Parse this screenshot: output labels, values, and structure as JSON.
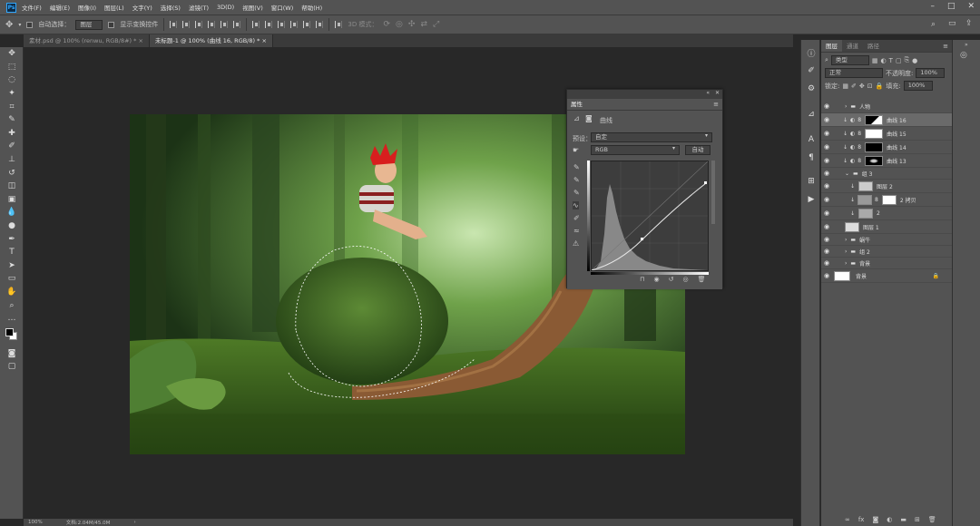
{
  "app": {
    "logo": "Ps"
  },
  "menubar": {
    "items": [
      "文件(F)",
      "编辑(E)",
      "图像(I)",
      "图层(L)",
      "文字(Y)",
      "选择(S)",
      "滤镜(T)",
      "3D(D)",
      "视图(V)",
      "窗口(W)",
      "帮助(H)"
    ]
  },
  "options": {
    "auto_select_label": "自动选择：",
    "auto_select_value": "图层",
    "show_transform_label": "显示变换控件",
    "mode3d_label": "3D 模式："
  },
  "tabs": [
    {
      "label": "素材.psd @ 100% (renwu, RGB/8#) *"
    },
    {
      "label": "未标题-1 @ 100% (曲线 16, RGB/8) *"
    }
  ],
  "status": {
    "zoom": "100%",
    "doc": "文档:2.04M/45.0M"
  },
  "properties": {
    "panel_title": "属性",
    "type": "曲线",
    "preset_label": "预设：",
    "preset_value": "自定",
    "channel_value": "RGB",
    "auto_label": "自动"
  },
  "layers_panel": {
    "tabs": [
      "图层",
      "通道",
      "路径"
    ],
    "filter_value": "类型",
    "blend_mode": "正常",
    "opacity_label": "不透明度:",
    "opacity_value": "100%",
    "lock_label": "锁定:",
    "fill_label": "填充:",
    "fill_value": "100%",
    "layers": [
      {
        "name": "人物"
      },
      {
        "name": "曲线 16"
      },
      {
        "name": "曲线 15"
      },
      {
        "name": "曲线 14"
      },
      {
        "name": "曲线 13"
      },
      {
        "name": "组 3"
      },
      {
        "name": "图层 2"
      },
      {
        "name": "2 拷贝"
      },
      {
        "name": "2"
      },
      {
        "name": "图层 1"
      },
      {
        "name": "蜗牛"
      },
      {
        "name": "组 2"
      },
      {
        "name": "背景"
      },
      {
        "name": "背景"
      }
    ]
  },
  "colors": {
    "ui_bg": "#535353",
    "canvas_bg": "#282828",
    "accent": "#31a8ff"
  }
}
